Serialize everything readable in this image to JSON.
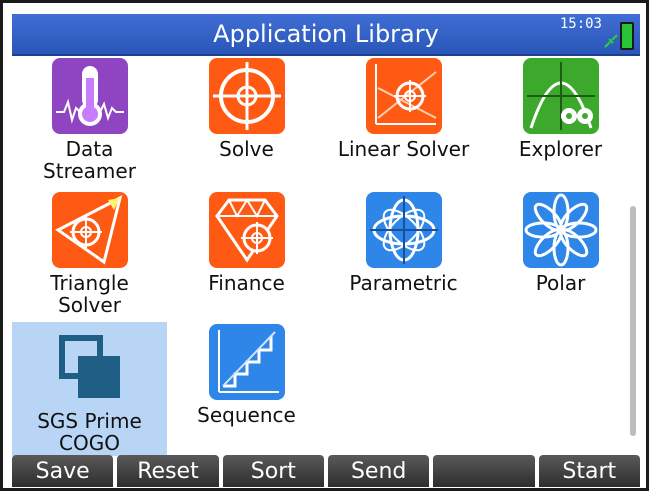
{
  "title": "Application Library",
  "status": {
    "time": "15:03"
  },
  "apps": [
    {
      "label": "Data\nStreamer",
      "icon": "thermometer-icon",
      "color": "#8f45c2",
      "selected": false
    },
    {
      "label": "Solve",
      "icon": "target-icon",
      "color": "#ff5a14",
      "selected": false
    },
    {
      "label": "Linear Solver",
      "icon": "linear-solver-icon",
      "color": "#ff5a14",
      "selected": false
    },
    {
      "label": "Explorer",
      "icon": "explorer-icon",
      "color": "#3ca92c",
      "selected": false
    },
    {
      "label": "Triangle\nSolver",
      "icon": "triangle-icon",
      "color": "#ff5a14",
      "selected": false
    },
    {
      "label": "Finance",
      "icon": "diamond-icon",
      "color": "#ff5a14",
      "selected": false
    },
    {
      "label": "Parametric",
      "icon": "parametric-icon",
      "color": "#2d86e8",
      "selected": false
    },
    {
      "label": "Polar",
      "icon": "flower-icon",
      "color": "#2d86e8",
      "selected": false
    },
    {
      "label": "SGS Prime\nCOGO",
      "icon": "cogo-icon",
      "color": "#1f5f86",
      "selected": true
    },
    {
      "label": "Sequence",
      "icon": "stairs-icon",
      "color": "#2d86e8",
      "selected": false
    }
  ],
  "softkeys": [
    "Save",
    "Reset",
    "Sort",
    "Send",
    "",
    "Start"
  ]
}
